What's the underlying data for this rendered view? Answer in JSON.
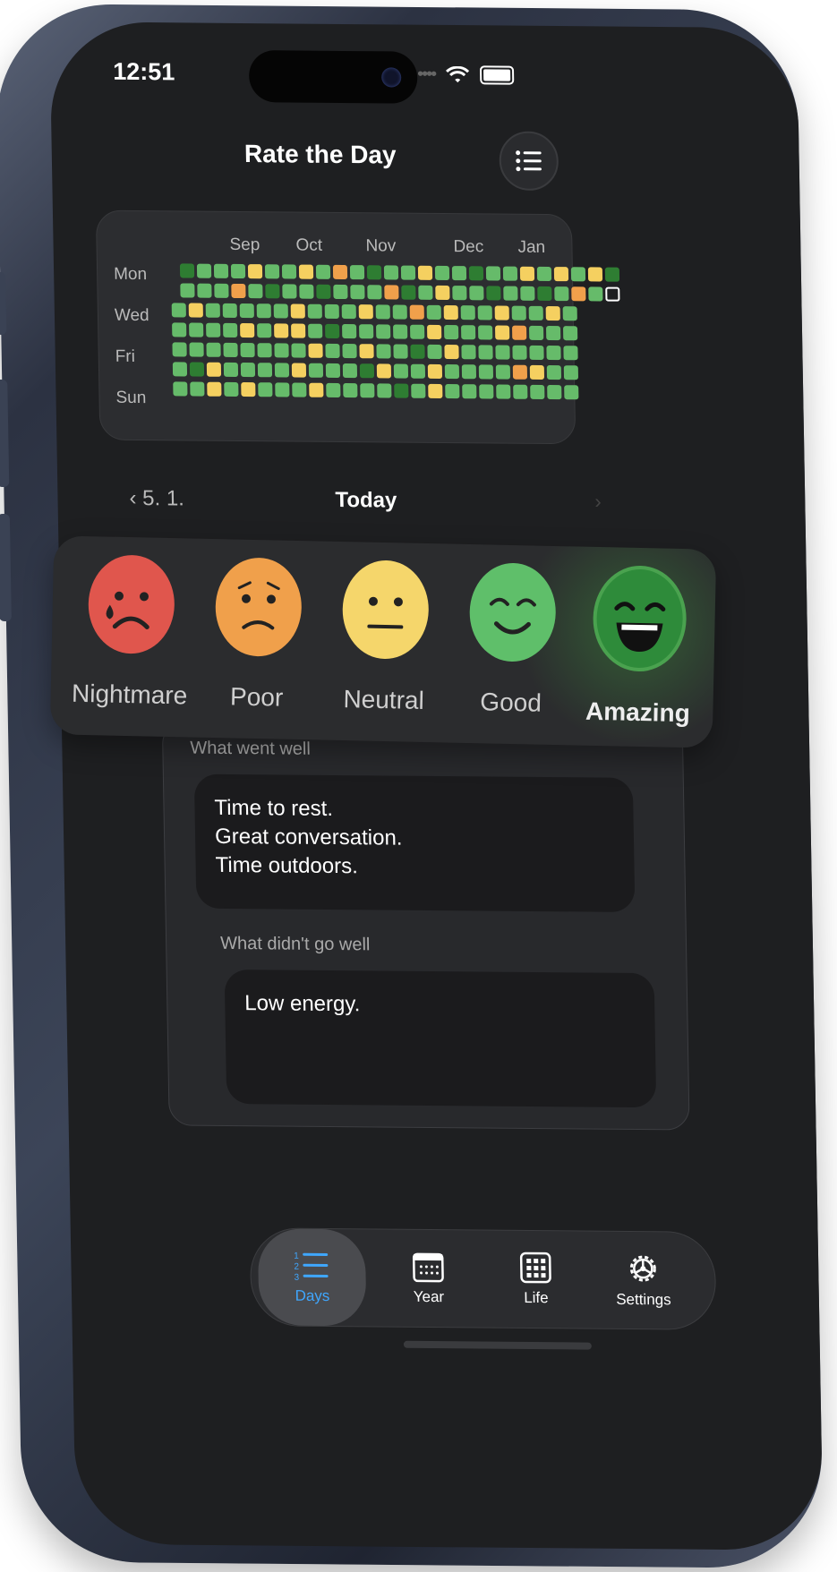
{
  "status_bar": {
    "time": "12:51",
    "dots": "••••"
  },
  "header": {
    "title": "Rate the Day",
    "menu_icon": "list-icon"
  },
  "heatmap": {
    "months": [
      "Sep",
      "Oct",
      "Nov",
      "Dec",
      "Jan"
    ],
    "weekdays": [
      "Mon",
      "Wed",
      "Fri",
      "Sun"
    ],
    "colors": {
      "amazing": "#2e7d32",
      "good": "#66bb6a",
      "neutral": "#f5d060",
      "poor": "#f0a04b",
      "nightmare": "#e05a4e"
    },
    "rows": [
      "AnnnNnnNnPnAnnNnnAnnNnNnNA",
      "nnnPnAnnAnnnPAnNnnAnnAnPnX",
      "nNnnnnnNnnnNnnPnNnnNnnNn",
      "nnnnNnNNnAnnnnnNnnnNPnnn",
      "nnnnnnnnNnnNnnAnNnnnnnnn",
      "nANnnnnNnnnANnnNnnnnPNnn",
      "nnNnNnnnNnnnnAnNnnnnnnnn"
    ]
  },
  "day_nav": {
    "prev_label": "‹ 5. 1.",
    "current_label": "Today",
    "next_label": "›"
  },
  "moods": [
    {
      "label": "Nightmare",
      "color": "#e0564d"
    },
    {
      "label": "Poor",
      "color": "#f0a04b"
    },
    {
      "label": "Neutral",
      "color": "#f5d66b"
    },
    {
      "label": "Good",
      "color": "#5fbf6a"
    },
    {
      "label": "Amazing",
      "color": "#2e8b3a",
      "selected": true
    }
  ],
  "form": {
    "went_well_label": "What went well",
    "went_well_text": "Time to rest.\n Great conversation.\n Time outdoors.",
    "went_badly_label": "What didn't go well",
    "went_badly_text": "Low energy."
  },
  "tabbar": {
    "tabs": [
      {
        "label": "Days",
        "icon": "numbered-list-icon",
        "active": true
      },
      {
        "label": "Year",
        "icon": "calendar-icon"
      },
      {
        "label": "Life",
        "icon": "grid-icon"
      },
      {
        "label": "Settings",
        "icon": "gear-icon"
      }
    ]
  }
}
